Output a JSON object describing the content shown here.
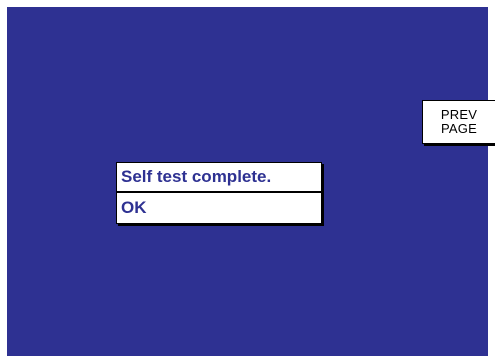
{
  "screen": {
    "background": "#2e3192"
  },
  "prev_page": {
    "line1": "PREV",
    "line2": "PAGE"
  },
  "dialog": {
    "message": "Self test complete.",
    "ok_label": "OK",
    "text_color": "#2e3192"
  }
}
